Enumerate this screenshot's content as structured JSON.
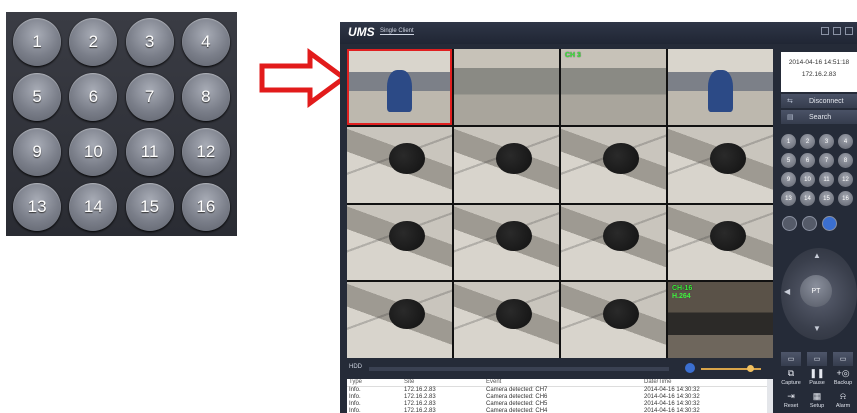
{
  "keypad": [
    "1",
    "2",
    "3",
    "4",
    "5",
    "6",
    "7",
    "8",
    "9",
    "10",
    "11",
    "12",
    "13",
    "14",
    "15",
    "16"
  ],
  "app": {
    "logo": "UMS",
    "subtitle": "Single Client"
  },
  "cameras": [
    {
      "label": "",
      "scene": "office",
      "selected": true
    },
    {
      "label": "",
      "scene": "office2"
    },
    {
      "label": "CH 3",
      "scene": "office2"
    },
    {
      "label": "",
      "scene": "office"
    },
    {
      "label": "",
      "scene": "head"
    },
    {
      "label": "",
      "scene": "head"
    },
    {
      "label": "",
      "scene": "head"
    },
    {
      "label": "",
      "scene": "head"
    },
    {
      "label": "",
      "scene": "head"
    },
    {
      "label": "",
      "scene": "head"
    },
    {
      "label": "",
      "scene": "head"
    },
    {
      "label": "",
      "scene": "head"
    },
    {
      "label": "",
      "scene": "head"
    },
    {
      "label": "",
      "scene": "head"
    },
    {
      "label": "",
      "scene": "head"
    },
    {
      "label": "CH-16",
      "label2": "H.264",
      "scene": "dark"
    }
  ],
  "playback": {
    "hdd_label": "HDD"
  },
  "log": {
    "headers": {
      "type": "Type",
      "site": "Site",
      "event": "Event",
      "date": "Date/Time"
    },
    "rows": [
      {
        "type": "Info.",
        "site": "172.16.2.83",
        "event": "Camera detected: CH7",
        "date": "2014-04-16 14:30:32"
      },
      {
        "type": "Info.",
        "site": "172.16.2.83",
        "event": "Camera detected: CH6",
        "date": "2014-04-16 14:30:32"
      },
      {
        "type": "Info.",
        "site": "172.16.2.83",
        "event": "Camera detected: CH5",
        "date": "2014-04-16 14:30:32"
      },
      {
        "type": "Info.",
        "site": "172.16.2.83",
        "event": "Camera detected: CH4",
        "date": "2014-04-16 14:30:32"
      }
    ]
  },
  "status": {
    "datetime": "2014-04-16 14:51:18",
    "ip": "172.16.2.83"
  },
  "buttons": {
    "disconnect": "Disconnect",
    "search": "Search"
  },
  "mini_keys": [
    "1",
    "2",
    "3",
    "4",
    "5",
    "6",
    "7",
    "8",
    "9",
    "10",
    "11",
    "12",
    "13",
    "14",
    "15",
    "16"
  ],
  "ptz": {
    "center": "PT"
  },
  "functions": {
    "capture": "Capture",
    "pause": "Pause",
    "backup": "Backup",
    "reset": "Reset",
    "setup": "Setup",
    "alarm": "Alarm"
  }
}
